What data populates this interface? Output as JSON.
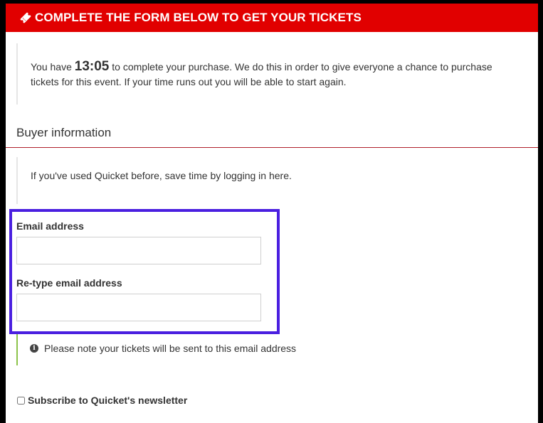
{
  "header": {
    "icon": "ticket-icon",
    "title": "COMPLETE THE FORM BELOW TO GET YOUR TICKETS"
  },
  "timer": {
    "prefix": "You have ",
    "value": "13:05",
    "suffix": " to complete your purchase. We do this in order to give everyone a chance to purchase tickets for this event. If your time runs out you will be able to start again."
  },
  "buyer": {
    "section_title": "Buyer information",
    "login_text": "If you've used Quicket before, save time by logging in here."
  },
  "form": {
    "email_label": "Email address",
    "email_value": "",
    "retype_label": "Re-type email address",
    "retype_value": ""
  },
  "note": {
    "icon": "info-circle-icon",
    "text": "Please note your tickets will be sent to this email address"
  },
  "subscribe": {
    "label": "Subscribe to Quicket's newsletter",
    "checked": false
  },
  "colors": {
    "header_bg": "#e10000",
    "highlight_border": "#4a1fe0",
    "note_border": "#8cc34a",
    "section_line": "#b0202b"
  }
}
